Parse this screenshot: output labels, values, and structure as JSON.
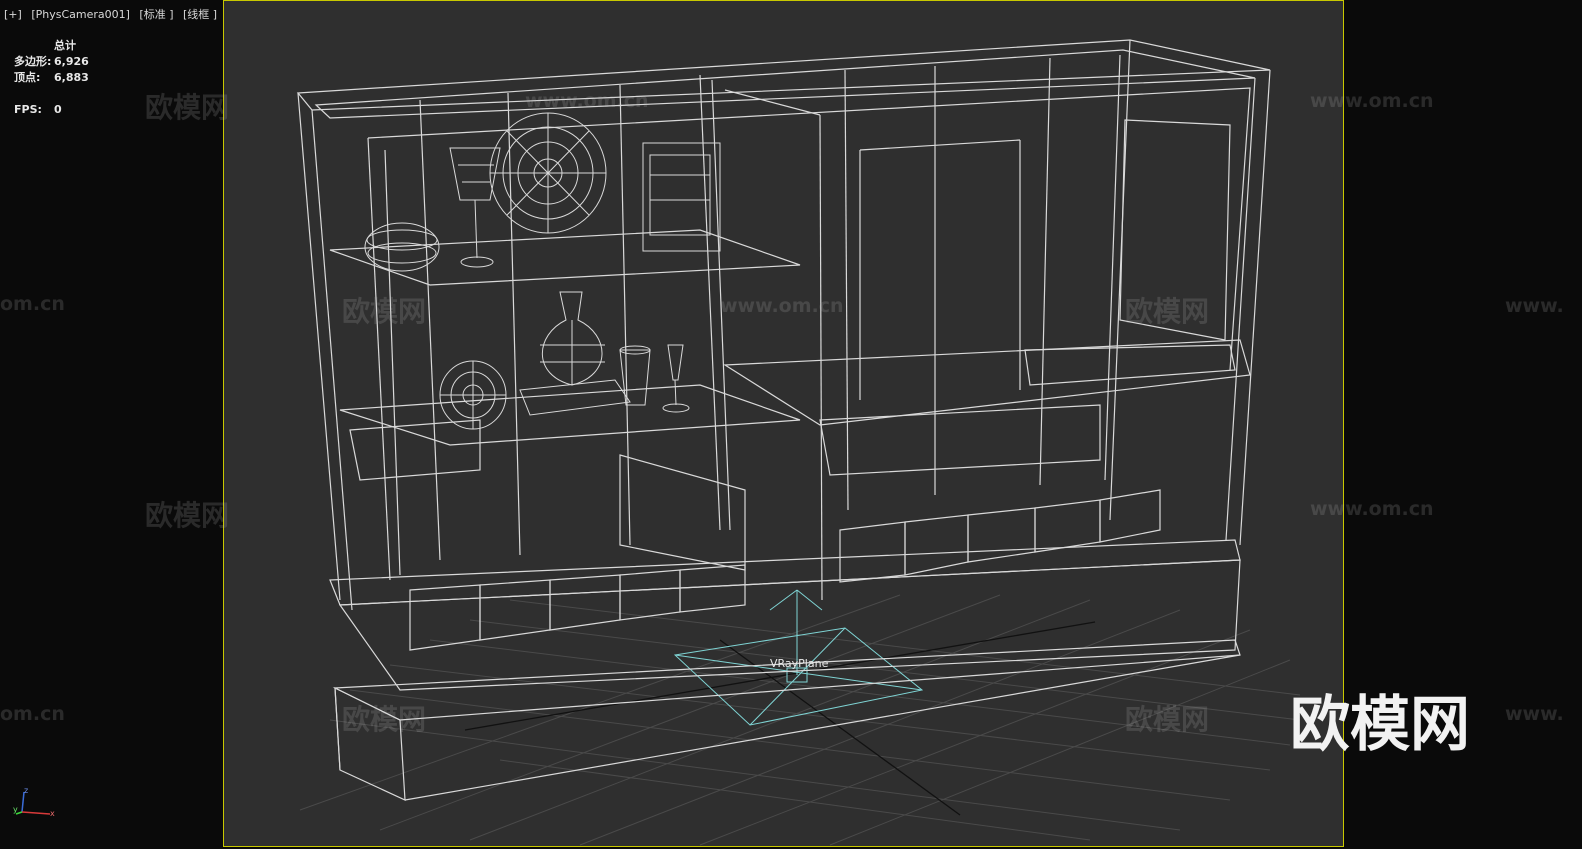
{
  "viewport": {
    "labels": [
      "[+]",
      "[PhysCamera001]",
      "[标准 ]",
      "[线框 ]"
    ]
  },
  "stats": {
    "header": "总计",
    "polys_label": "多边形:",
    "polys_value": "6,926",
    "verts_label": "顶点:",
    "verts_value": "6,883",
    "fps_label": "FPS:",
    "fps_value": "0"
  },
  "scene": {
    "object_label": "VRayPlane"
  },
  "watermarks": {
    "cn": "欧模网",
    "url": "www.om.cn",
    "url_short": "om.cn",
    "url_partial": "www.",
    "logo": "欧模网"
  },
  "axis": {
    "x": "x",
    "y": "y",
    "z": "z"
  },
  "colors": {
    "viewport_bg": "#2f2f2f",
    "wire": "#d9d9d9",
    "active_border": "#c8c800",
    "vray_plane": "#7fd4d4"
  }
}
